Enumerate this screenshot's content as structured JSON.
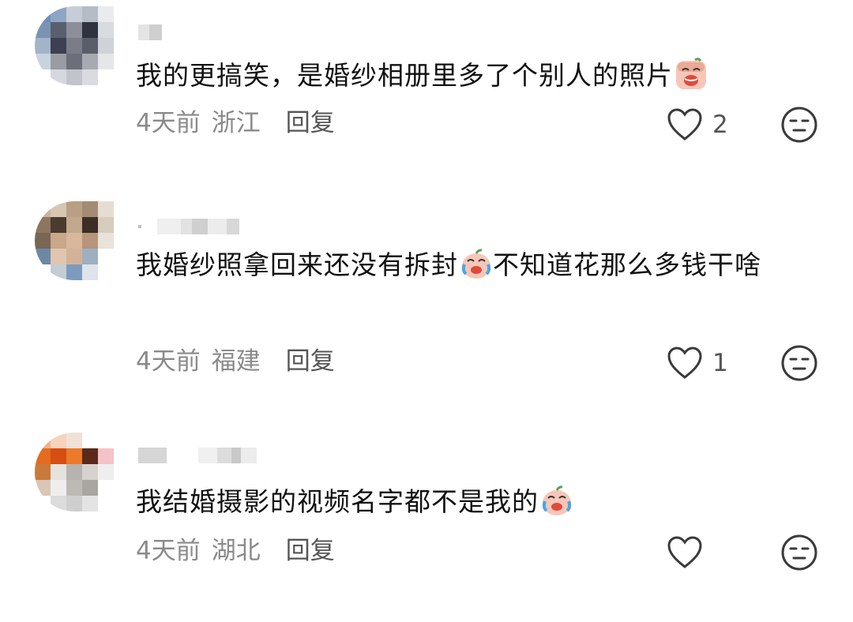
{
  "comments": [
    {
      "text": "我的更搞笑，是婚纱相册里多了个别人的照片",
      "emoji": "crying-face-emoji",
      "time": "4天前",
      "location": "浙江",
      "reply_label": "回复",
      "likes": "2"
    },
    {
      "text": "我婚纱照拿回来还没有拆封",
      "text_after_emoji": "不知道花那么多钱干啥",
      "emoji": "crying-face-emoji",
      "time": "4天前",
      "location": "福建",
      "reply_label": "回复",
      "likes": "1"
    },
    {
      "text": "我结婚摄影的视频名字都不是我的",
      "emoji": "crying-face-emoji",
      "time": "4天前",
      "location": "湖北",
      "reply_label": "回复",
      "likes": ""
    }
  ],
  "icons": {
    "like": "heart-outline-icon",
    "dislike": "neutral-face-icon"
  },
  "colors": {
    "text": "#111111",
    "meta": "#8a8a8a",
    "icon": "#3a3a3a"
  }
}
